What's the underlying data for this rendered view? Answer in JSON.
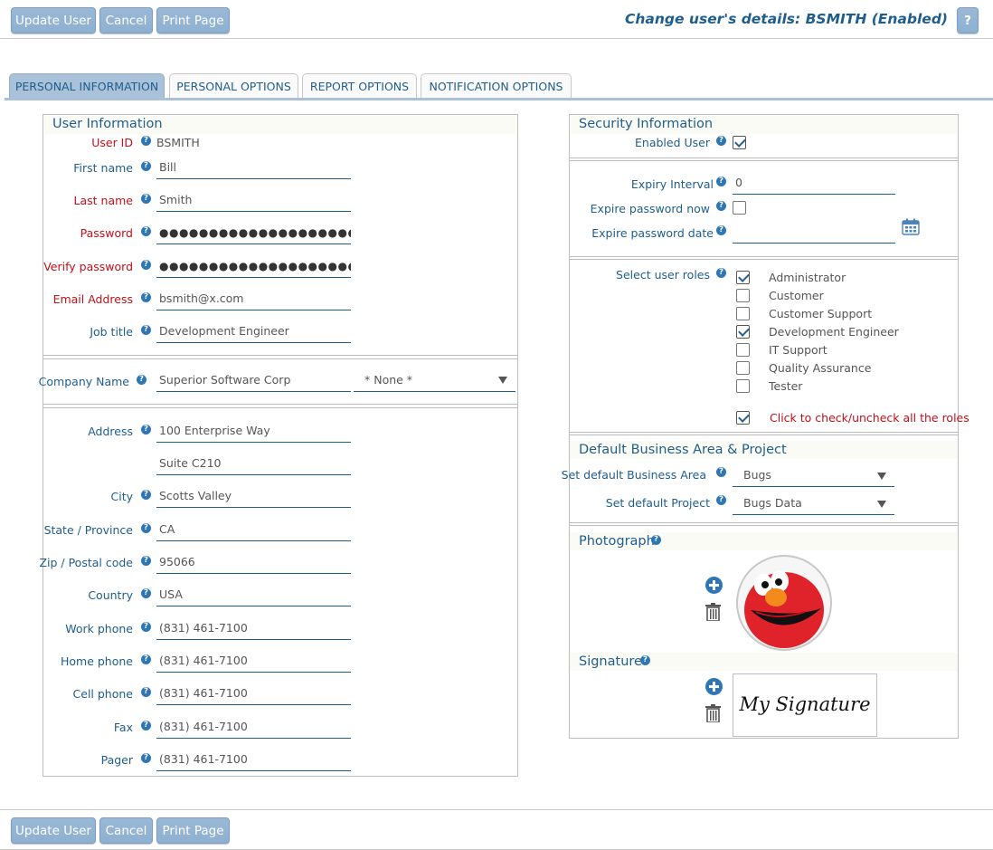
{
  "toolbar": {
    "update_label": "Update User",
    "cancel_label": "Cancel",
    "print_label": "Print Page",
    "help_label": "?"
  },
  "page_title": "Change user's details: BSMITH (Enabled)",
  "tabs": [
    {
      "label": "PERSONAL INFORMATION",
      "active": true
    },
    {
      "label": "PERSONAL OPTIONS",
      "active": false
    },
    {
      "label": "REPORT OPTIONS",
      "active": false
    },
    {
      "label": "NOTIFICATION OPTIONS",
      "active": false
    }
  ],
  "user_info": {
    "title": "User Information",
    "user_id_label": "User ID",
    "user_id_value": "BSMITH",
    "first_name_label": "First name",
    "first_name": "Bill",
    "last_name_label": "Last name",
    "last_name": "Smith",
    "password_label": "Password",
    "password": "●●●●●●●●●●●●●●●●●●●●",
    "verify_password_label": "Verify password",
    "verify_password": "●●●●●●●●●●●●●●●●●●●●",
    "email_label": "Email Address",
    "email": "bsmith@x.com",
    "job_title_label": "Job title",
    "job_title": "Development Engineer",
    "company_label": "Company Name",
    "company": "Superior Software Corp",
    "company_select": "* None *",
    "address_label": "Address",
    "address1": "100 Enterprise Way",
    "address2": "Suite C210",
    "city_label": "City",
    "city": "Scotts Valley",
    "state_label": "State / Province",
    "state": "CA",
    "zip_label": "Zip / Postal code",
    "zip": "95066",
    "country_label": "Country",
    "country": "USA",
    "work_phone_label": "Work phone",
    "work_phone": "(831) 461-7100",
    "home_phone_label": "Home phone",
    "home_phone": "(831) 461-7100",
    "cell_phone_label": "Cell phone",
    "cell_phone": "(831) 461-7100",
    "fax_label": "Fax",
    "fax": "(831) 461-7100",
    "pager_label": "Pager",
    "pager": "(831) 461-7100"
  },
  "security": {
    "title": "Security Information",
    "enabled_label": "Enabled User",
    "enabled": true,
    "expiry_interval_label": "Expiry Interval",
    "expiry_interval": "0",
    "expire_now_label": "Expire password now",
    "expire_now": false,
    "expire_date_label": "Expire password date",
    "expire_date": "",
    "roles_label": "Select user roles",
    "roles": [
      {
        "label": "Administrator",
        "checked": true
      },
      {
        "label": "Customer",
        "checked": false
      },
      {
        "label": "Customer Support",
        "checked": false
      },
      {
        "label": "Development Engineer",
        "checked": true
      },
      {
        "label": "IT Support",
        "checked": false
      },
      {
        "label": "Quality Assurance",
        "checked": false
      },
      {
        "label": "Tester",
        "checked": false
      }
    ],
    "toggle_all_label": "Click to check/uncheck all the roles",
    "toggle_all_checked": true
  },
  "defaults": {
    "title": "Default Business Area & Project",
    "business_area_label": "Set default Business Area",
    "business_area": "Bugs",
    "project_label": "Set default Project",
    "project": "Bugs Data"
  },
  "photo": {
    "title": "Photograph",
    "signature_title": "Signature",
    "signature_text": "My Signature"
  },
  "colors": {
    "accent": "#1f5d8c",
    "required": "#c0101a",
    "button": "#8eb0d0",
    "help": "#2e77b4"
  }
}
